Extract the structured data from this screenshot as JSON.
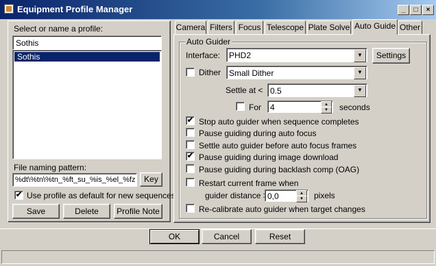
{
  "window": {
    "title": "Equipment Profile Manager"
  },
  "left": {
    "select_label": "Select or name a profile:",
    "profile_name_value": "Sothis",
    "profiles": [
      "Sothis"
    ],
    "file_naming_label": "File naming pattern:",
    "file_naming_value": "%dt\\%tn\\%tn_%ft_su_%is_%el_%fz",
    "key_button": "Key",
    "default_checkbox_label": "Use profile as default for new sequences",
    "default_checked": true,
    "save_button": "Save",
    "delete_button": "Delete",
    "note_button": "Profile Note"
  },
  "tabs": [
    "Camera",
    "Filters",
    "Focus",
    "Telescope",
    "Plate Solve",
    "Auto Guide",
    "Other"
  ],
  "active_tab": "Auto Guide",
  "guider": {
    "group_label": "Auto Guider",
    "interface_label": "Interface:",
    "interface_value": "PHD2",
    "settings_button": "Settings",
    "dither_label": "Dither",
    "dither_checked": false,
    "dither_value": "Small Dither",
    "settle_label": "Settle at <",
    "settle_value": "0.5",
    "for_label": "For",
    "for_checked": false,
    "for_value": "4",
    "seconds_label": "seconds",
    "options": [
      {
        "label": "Stop auto guider when sequence completes",
        "checked": true
      },
      {
        "label": "Pause guiding during auto focus",
        "checked": false
      },
      {
        "label": "Settle auto guider before auto focus frames",
        "checked": false
      },
      {
        "label": "Pause guiding during image download",
        "checked": true
      },
      {
        "label": "Pause guiding during backlash comp (OAG)",
        "checked": false
      },
      {
        "label": "Restart current frame when",
        "checked": false
      }
    ],
    "guider_distance_label": "guider distance >",
    "guider_distance_value": "0,0",
    "pixels_label": "pixels",
    "recalibrate_label": "Re-calibrate auto guider when target changes",
    "recalibrate_checked": false
  },
  "footer": {
    "ok_button": "OK",
    "cancel_button": "Cancel",
    "reset_button": "Reset"
  },
  "icons": {
    "check": "✔",
    "dropdown": "▼",
    "spin_up": "▲",
    "spin_down": "▼"
  }
}
